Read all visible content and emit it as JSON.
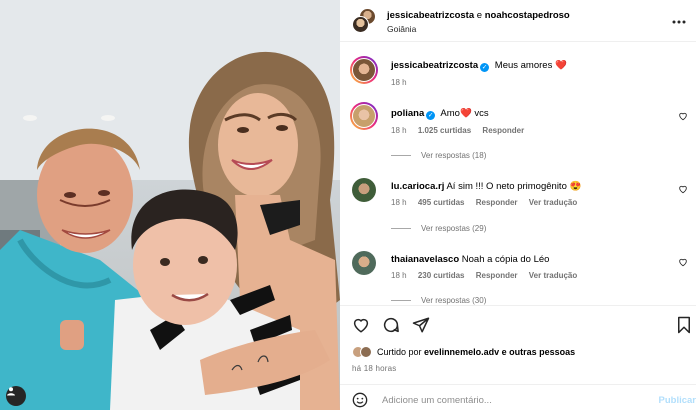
{
  "header": {
    "user1": "jessicabeatrizcosta",
    "connector": "e",
    "user2": "noahcostapedroso",
    "location": "Goiânia"
  },
  "caption": {
    "username": "jessicabeatrizcosta",
    "text": "Meus amores",
    "emoji": "❤️",
    "time": "18 h"
  },
  "comments": [
    {
      "username": "poliana",
      "verified": true,
      "text_before": "Amo",
      "emoji": "❤️",
      "text_after": "vcs",
      "time": "18 h",
      "likes": "1.025 curtidas",
      "reply": "Responder",
      "translate": "",
      "view_replies": "Ver respostas (18)"
    },
    {
      "username": "lu.carioca.rj",
      "verified": false,
      "text_before": "Aí sim !!! O neto primogênito",
      "emoji": "😍",
      "text_after": "",
      "time": "18 h",
      "likes": "495 curtidas",
      "reply": "Responder",
      "translate": "Ver tradução",
      "view_replies": "Ver respostas (29)"
    },
    {
      "username": "thaianavelasco",
      "verified": false,
      "text_before": "Noah a cópia do Léo",
      "emoji": "",
      "text_after": "",
      "time": "18 h",
      "likes": "230 curtidas",
      "reply": "Responder",
      "translate": "Ver tradução",
      "view_replies": "Ver respostas (30)"
    }
  ],
  "likes_summary": {
    "prefix": "Curtido por",
    "user": "evelinnemelo.adv",
    "suffix": "e outras pessoas"
  },
  "post_time": "há 18 horas",
  "comment_box": {
    "placeholder": "Adicione um comentário...",
    "publish": "Publicar"
  },
  "icons": {
    "more": "more-horizontal-icon",
    "like": "heart-outline-icon",
    "comment": "comment-bubble-icon",
    "share": "paper-plane-icon",
    "save": "bookmark-icon",
    "emoji": "smiley-icon",
    "tagged_users": "person-icon"
  },
  "colors": {
    "verified": "#0095f6",
    "heart": "#e0245e",
    "muted": "#737373",
    "publish": "#b2dffc"
  }
}
